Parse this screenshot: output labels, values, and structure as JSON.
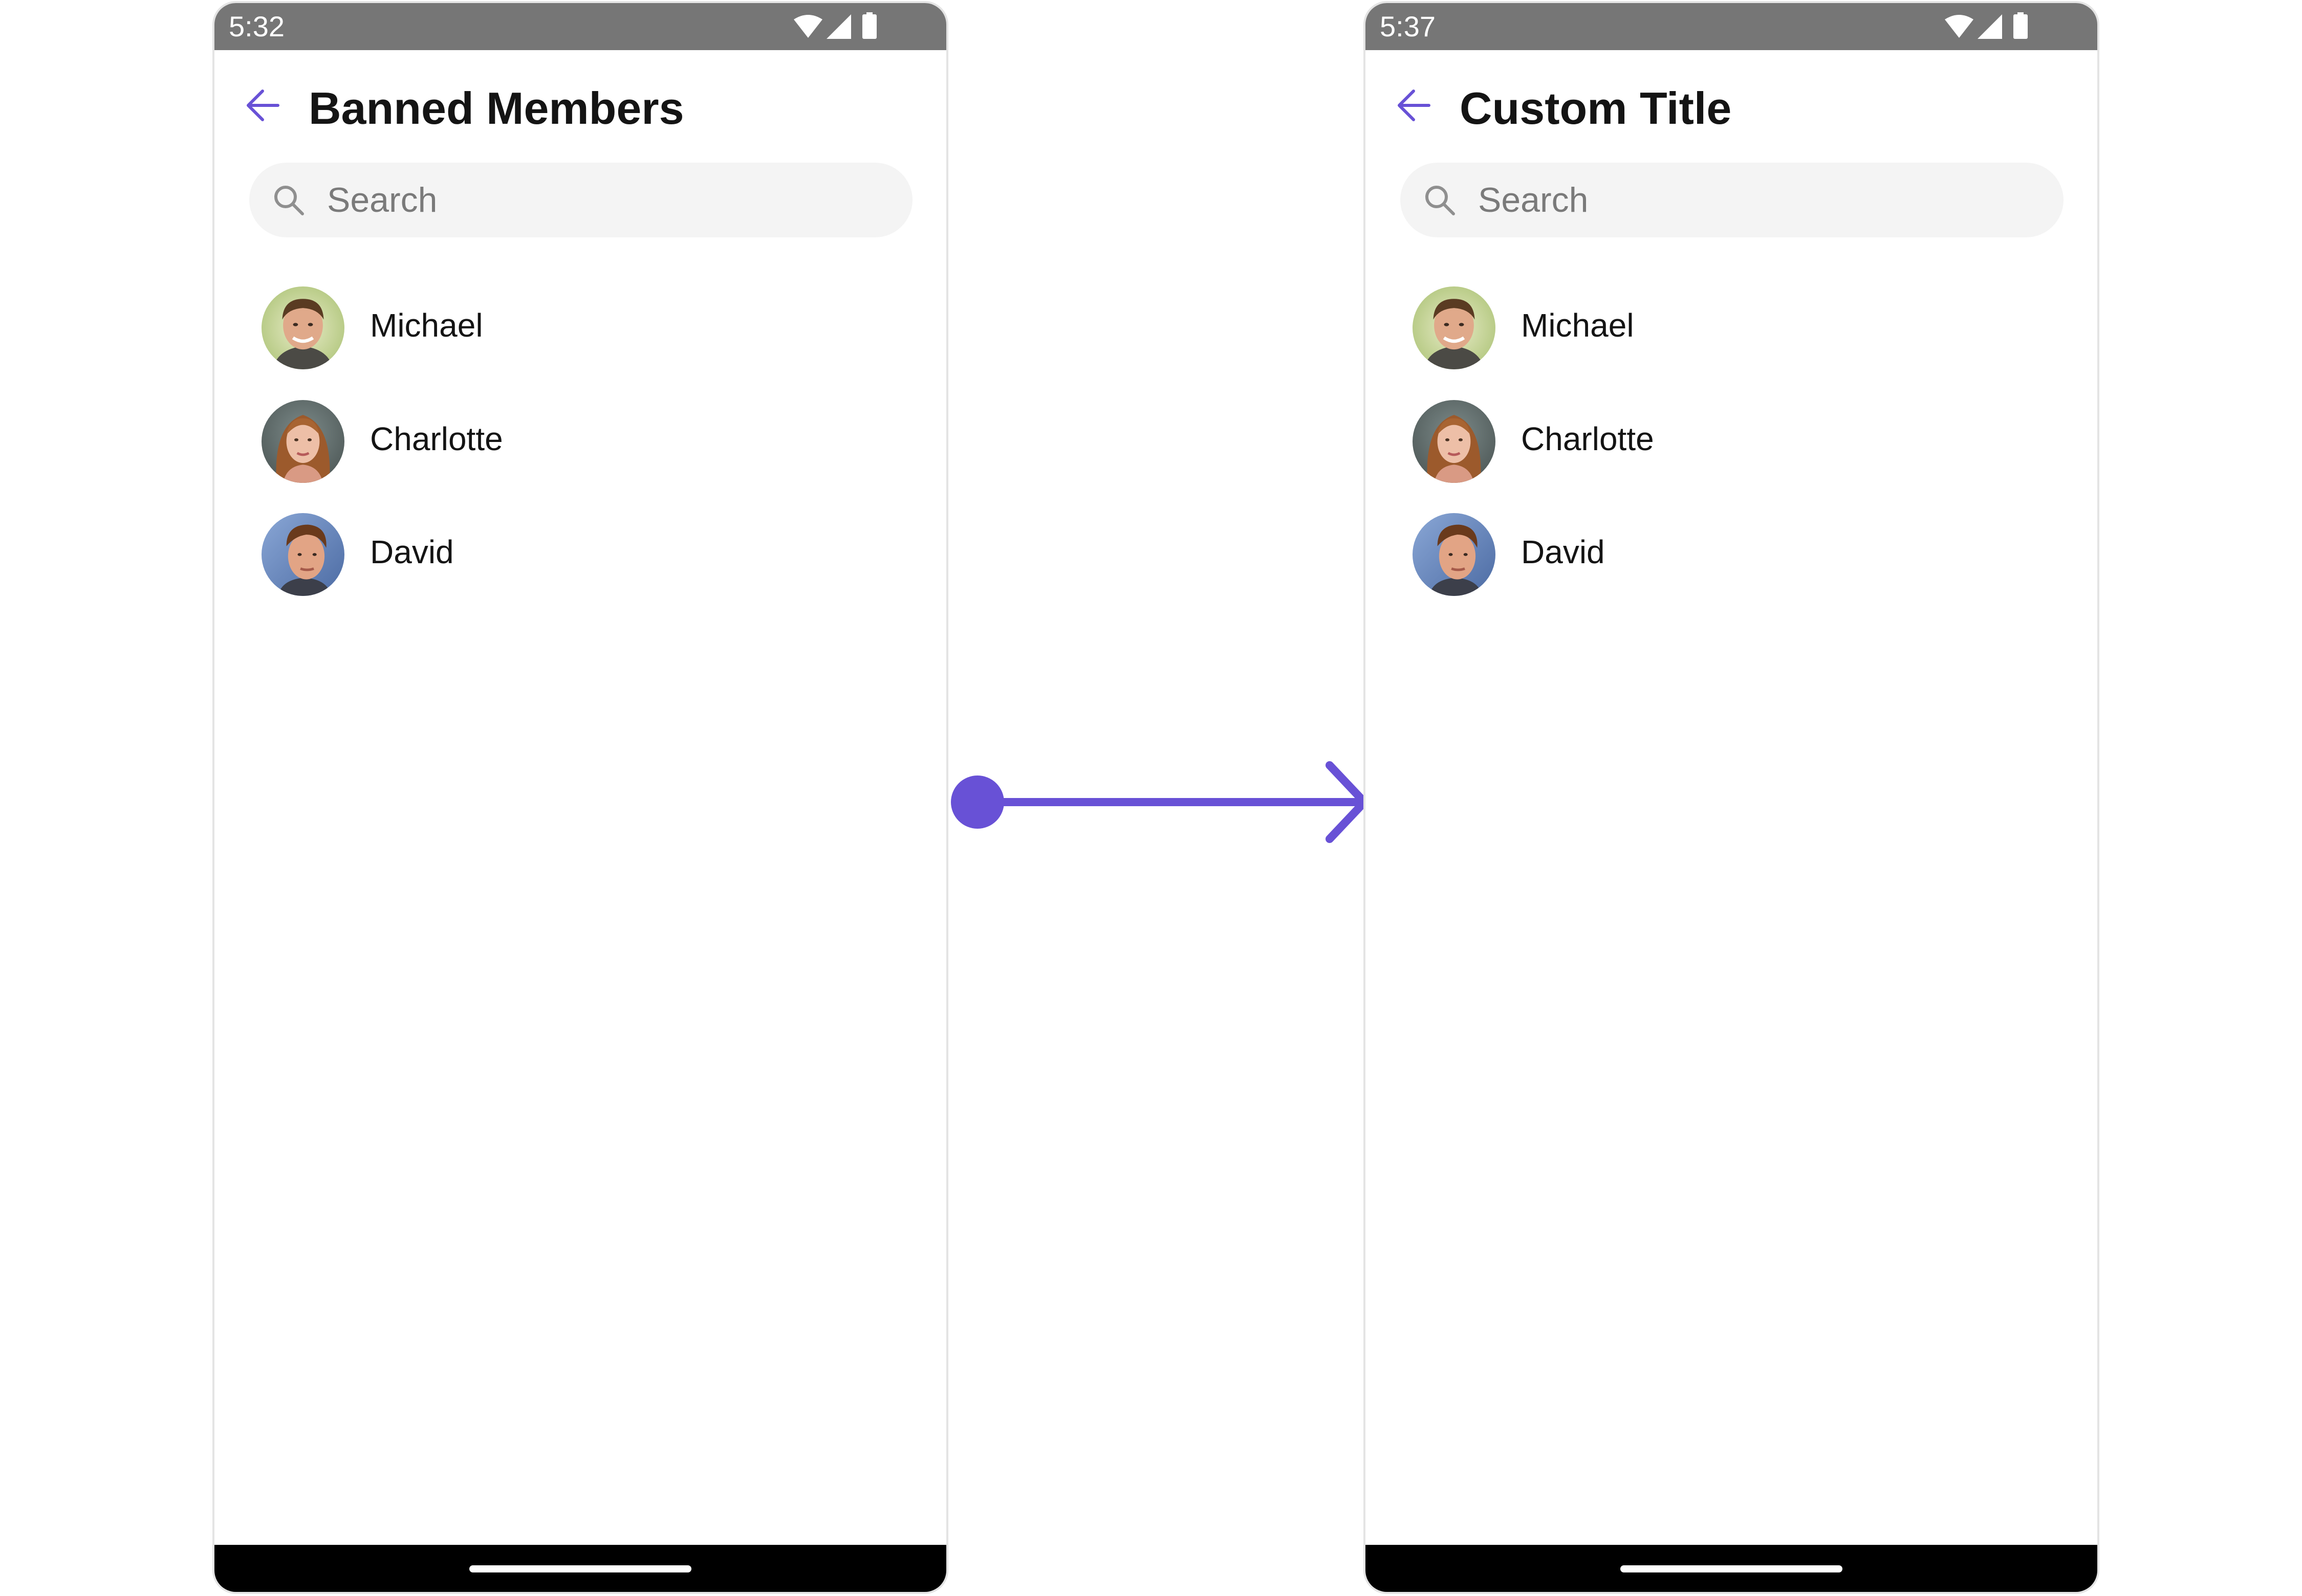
{
  "colors": {
    "accent": "#6851d6",
    "status_bar": "#767676",
    "search_bg": "#f4f4f4",
    "text_primary": "#141414",
    "text_secondary": "#7a7a7a",
    "nav_bar": "#000000"
  },
  "screens": [
    {
      "status": {
        "time": "5:32",
        "icons": [
          "wifi-icon",
          "signal-icon",
          "battery-icon"
        ]
      },
      "header": {
        "back_icon": "arrow-left-icon",
        "title": "Banned Members"
      },
      "search": {
        "placeholder": "Search",
        "icon": "search-icon"
      },
      "members": [
        {
          "name": "Michael",
          "avatar": "avatar-michael"
        },
        {
          "name": "Charlotte",
          "avatar": "avatar-charlotte"
        },
        {
          "name": "David",
          "avatar": "avatar-david"
        }
      ]
    },
    {
      "status": {
        "time": "5:37",
        "icons": [
          "wifi-icon",
          "signal-icon",
          "battery-icon"
        ]
      },
      "header": {
        "back_icon": "arrow-left-icon",
        "title": "Custom Title"
      },
      "search": {
        "placeholder": "Search",
        "icon": "search-icon"
      },
      "members": [
        {
          "name": "Michael",
          "avatar": "avatar-michael"
        },
        {
          "name": "Charlotte",
          "avatar": "avatar-charlotte"
        },
        {
          "name": "David",
          "avatar": "avatar-david"
        }
      ]
    }
  ],
  "transition": {
    "icon": "arrow-right-icon"
  }
}
